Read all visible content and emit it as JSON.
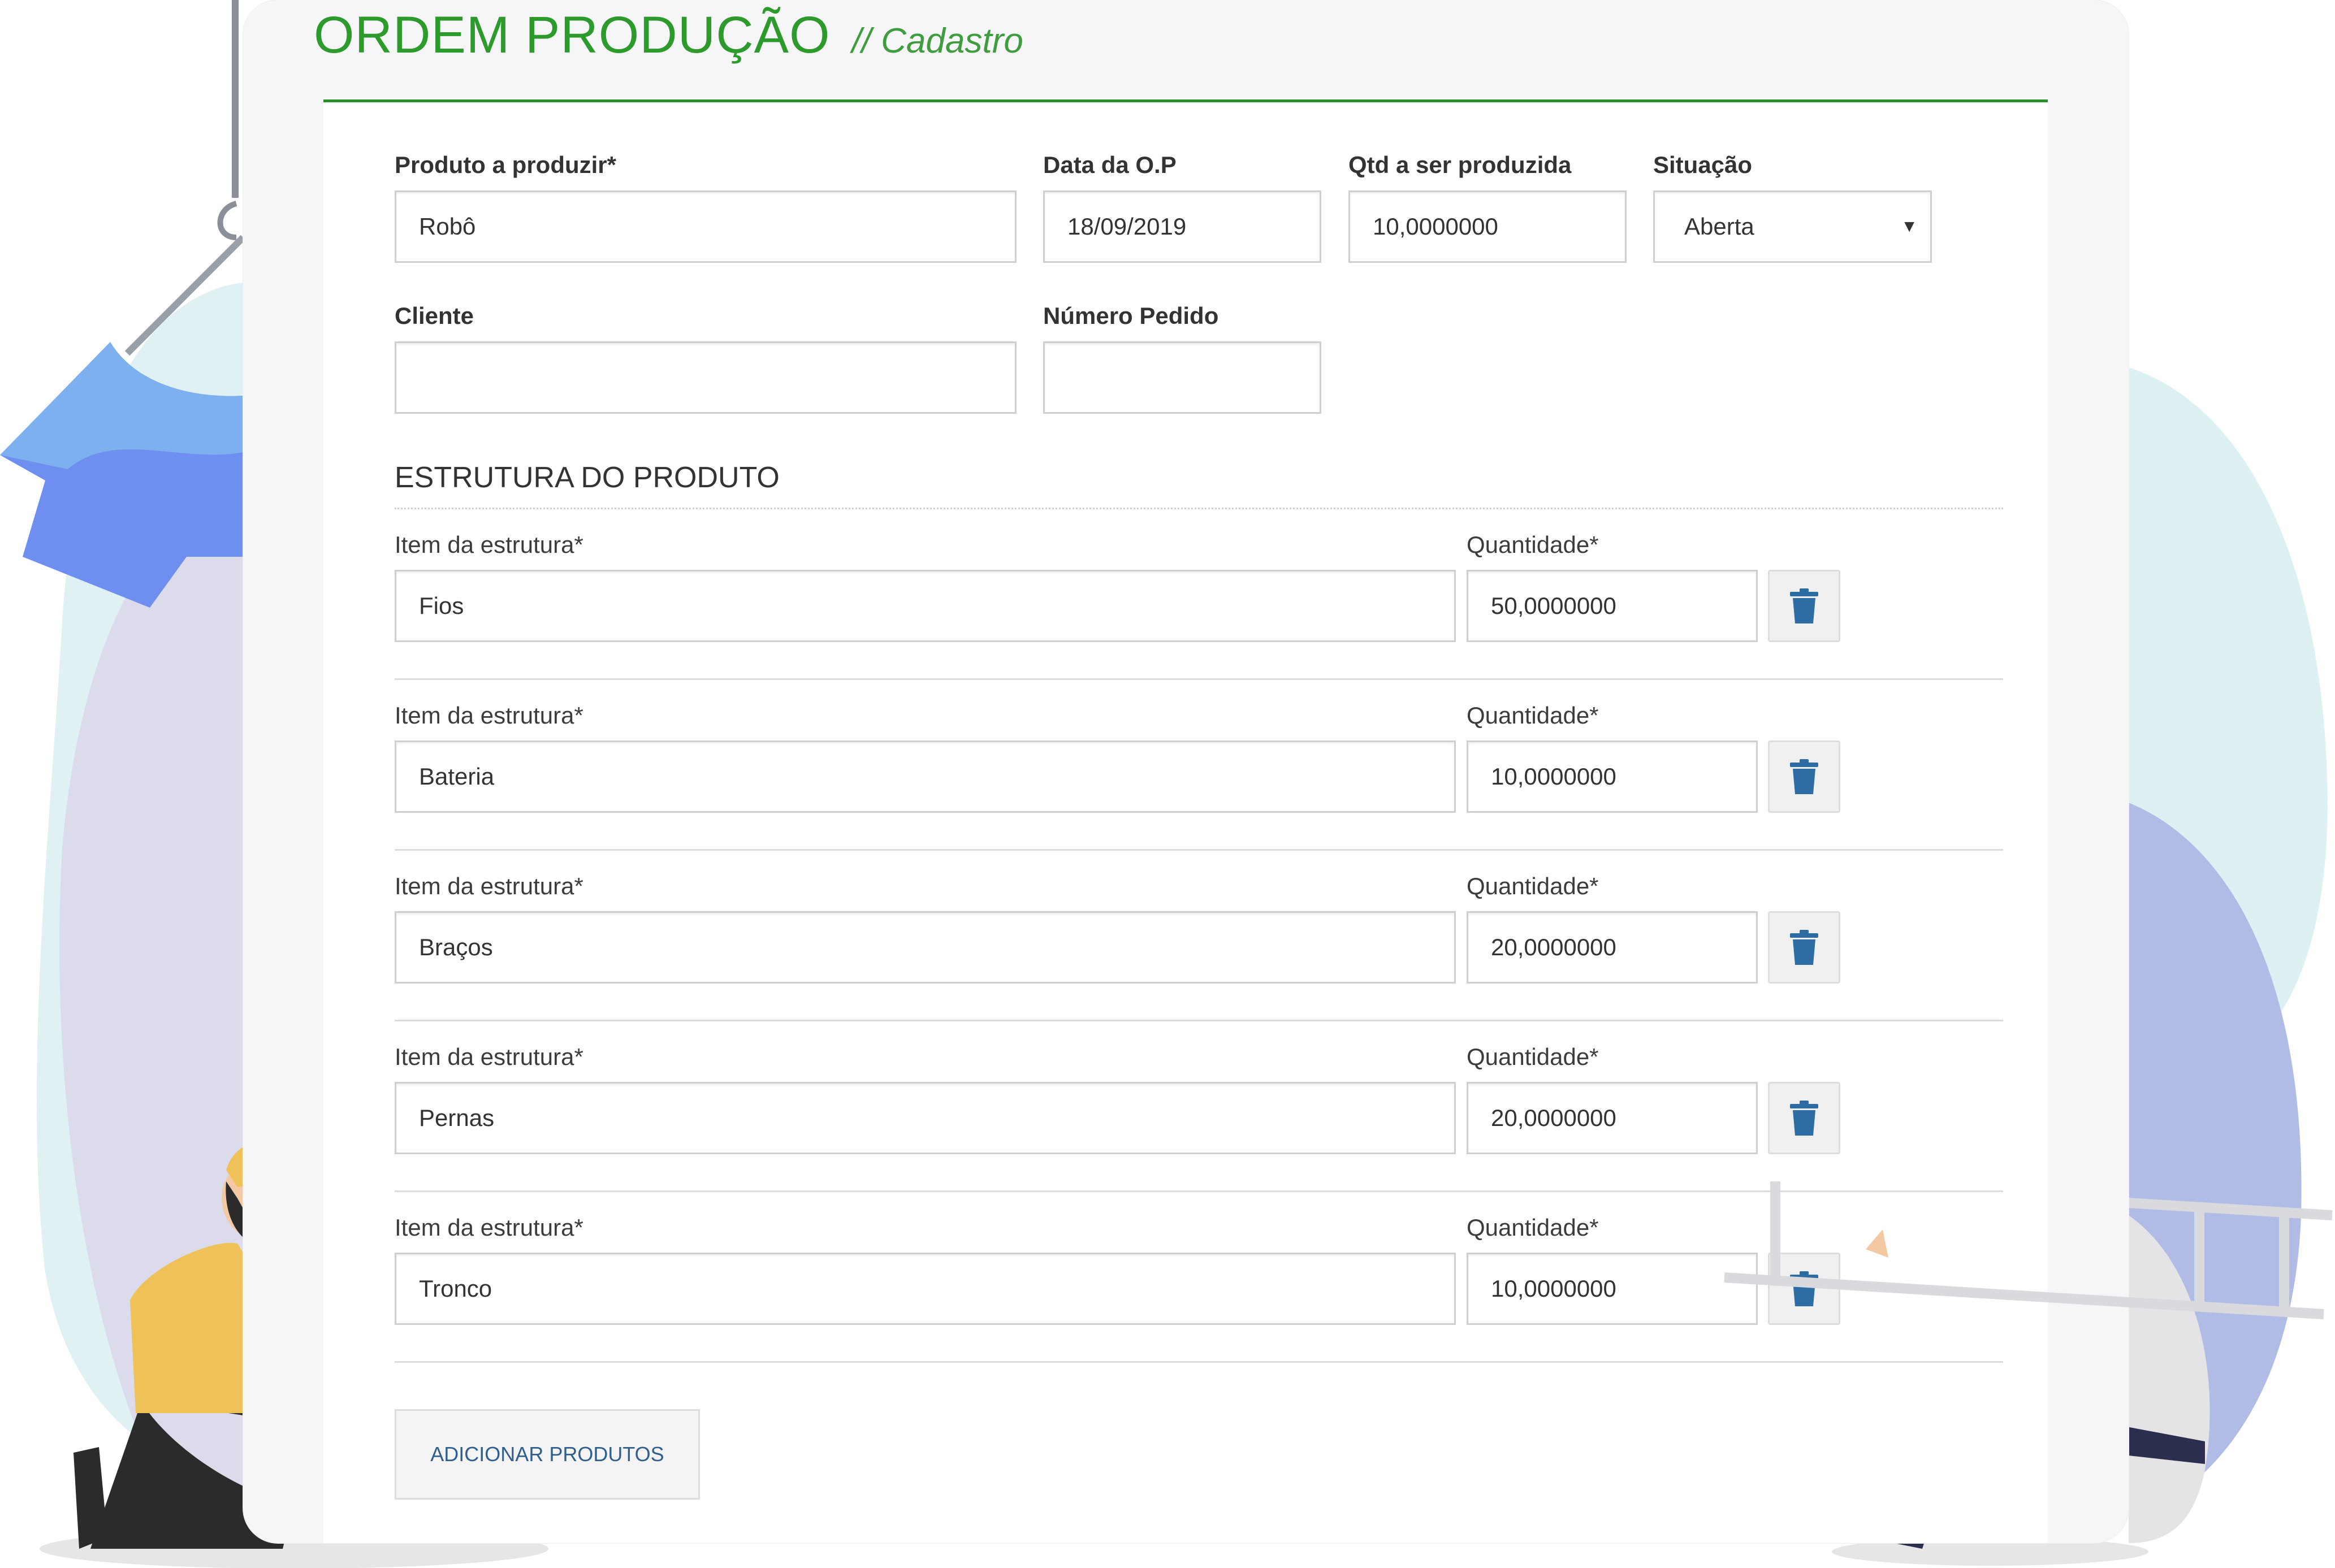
{
  "header": {
    "title": "ORDEM PRODUÇÃO",
    "subtitle": "// Cadastro"
  },
  "form": {
    "produto": {
      "label": "Produto a produzir*",
      "value": "Robô"
    },
    "data_op": {
      "label": "Data da O.P",
      "value": "18/09/2019"
    },
    "qtd": {
      "label": "Qtd a ser produzida",
      "value": "10,0000000"
    },
    "situacao": {
      "label": "Situação",
      "value": "Aberta"
    },
    "cliente": {
      "label": "Cliente",
      "value": ""
    },
    "numero_pedido": {
      "label": "Número Pedido",
      "value": ""
    }
  },
  "estrutura": {
    "section_title": "ESTRUTURA DO PRODUTO",
    "item_label": "Item da estrutura*",
    "qty_label": "Quantidade*",
    "rows": [
      {
        "item": "Fios",
        "qty": "50,0000000"
      },
      {
        "item": "Bateria",
        "qty": "10,0000000"
      },
      {
        "item": "Braços",
        "qty": "20,0000000"
      },
      {
        "item": "Pernas",
        "qty": "20,0000000"
      },
      {
        "item": "Tronco",
        "qty": "10,0000000"
      }
    ]
  },
  "actions": {
    "add_label": "ADICIONAR PRODUTOS"
  },
  "icons": {
    "delete": "trash-icon",
    "dropdown": "caret-down-icon"
  },
  "colors": {
    "brand": "#2c9b2c",
    "delete_icon": "#2e6da4",
    "add_text": "#2f5f8f"
  }
}
